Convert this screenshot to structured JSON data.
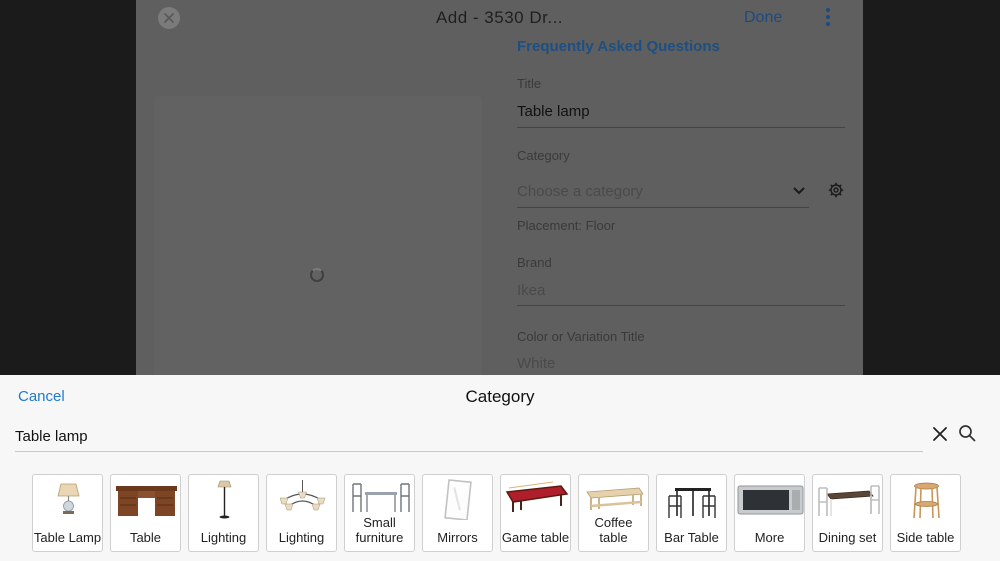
{
  "modal": {
    "title": "Add - 3530 Dr...",
    "done_label": "Done",
    "faq_link": "Frequently Asked Questions",
    "fields": {
      "title_label": "Title",
      "title_value": "Table lamp",
      "category_label": "Category",
      "category_placeholder": "Choose a category",
      "placement_text": "Placement: Floor",
      "brand_label": "Brand",
      "brand_placeholder": "Ikea",
      "color_label": "Color or Variation Title",
      "color_placeholder": "White"
    }
  },
  "sheet": {
    "cancel_label": "Cancel",
    "title": "Category",
    "search_value": "Table lamp",
    "search_placeholder": "Search",
    "tiles": [
      {
        "label": "Table Lamp",
        "icon": "table-lamp-icon"
      },
      {
        "label": "Table",
        "icon": "desk-icon"
      },
      {
        "label": "Lighting",
        "icon": "floor-lamp-icon"
      },
      {
        "label": "Lighting",
        "icon": "chandelier-icon"
      },
      {
        "label": "Small furniture",
        "icon": "dining-chairs-icon"
      },
      {
        "label": "Mirrors",
        "icon": "mirror-icon"
      },
      {
        "label": "Game table",
        "icon": "pool-table-icon"
      },
      {
        "label": "Coffee table",
        "icon": "coffee-table-icon"
      },
      {
        "label": "Bar Table",
        "icon": "bar-table-icon"
      },
      {
        "label": "More",
        "icon": "microwave-icon"
      },
      {
        "label": "Dining set",
        "icon": "dining-set-icon"
      },
      {
        "label": "Side table",
        "icon": "side-table-icon"
      }
    ]
  },
  "colors": {
    "accent": "#1e7ad0",
    "sheet_bg": "#f7f7f7",
    "overlay_bg": "#1b1b1b"
  }
}
